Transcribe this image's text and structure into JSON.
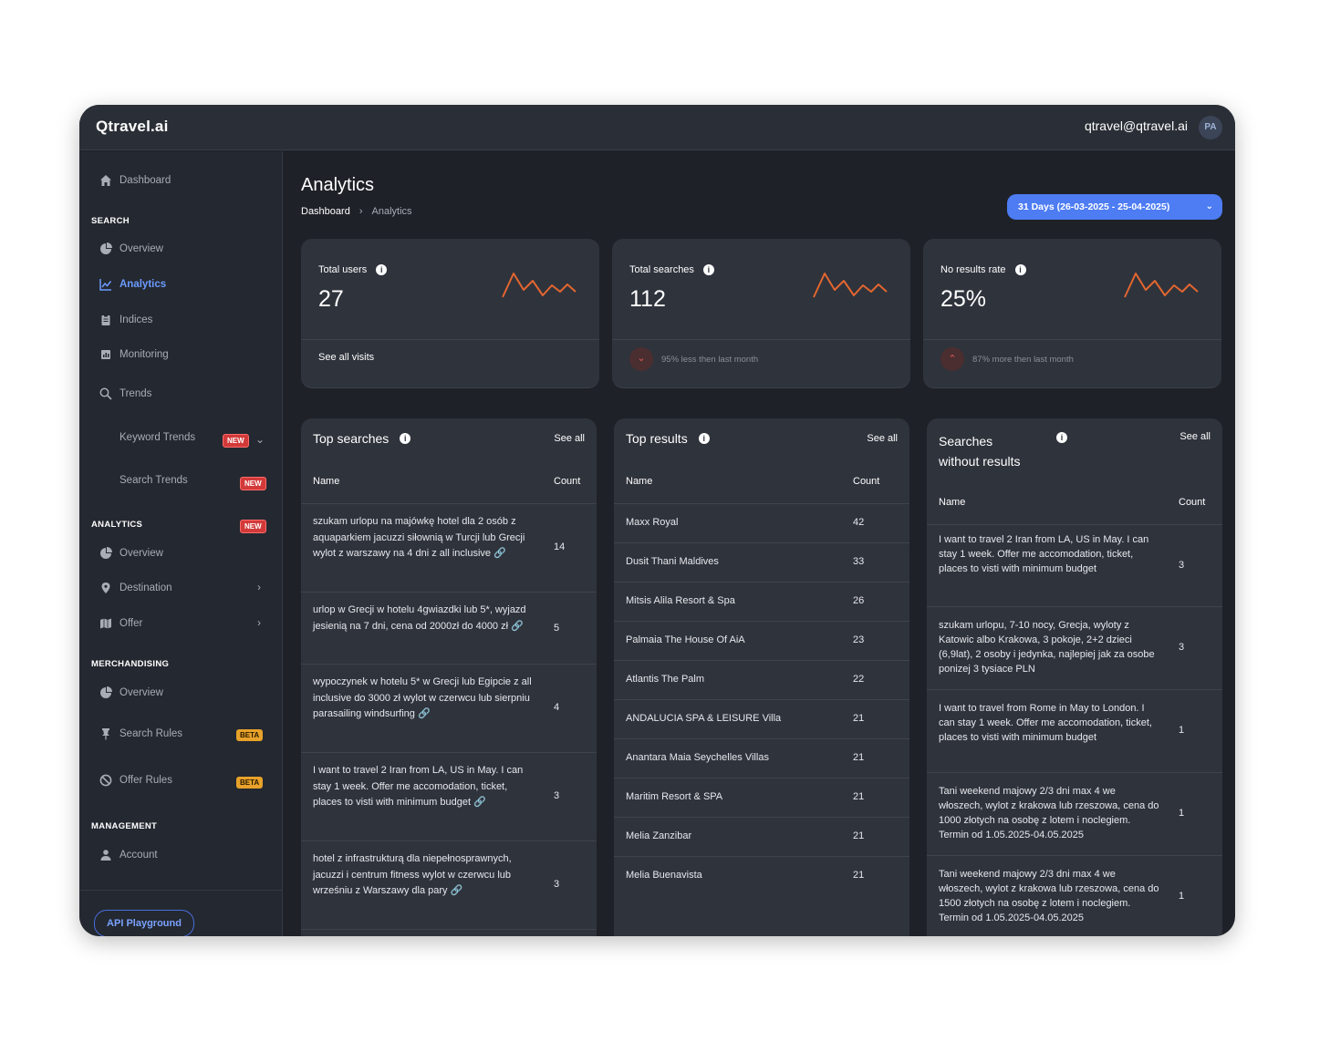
{
  "header": {
    "logo": "Qtravel.ai",
    "email": "qtravel@qtravel.ai",
    "avatar": "PA"
  },
  "sidebar": {
    "dashboard": "Dashboard",
    "sections": {
      "search": "SEARCH",
      "analytics": "ANALYTICS",
      "merchandising": "MERCHANDISING",
      "management": "MANAGEMENT"
    },
    "search_items": {
      "overview": "Overview",
      "analytics": "Analytics",
      "indices": "Indices",
      "monitoring": "Monitoring",
      "trends": "Trends",
      "keyword_trends": "Keyword Trends",
      "search_trends": "Search Trends"
    },
    "analytics_items": {
      "overview": "Overview",
      "destination": "Destination",
      "offer": "Offer"
    },
    "merch_items": {
      "overview": "Overview",
      "search_rules": "Search Rules",
      "offer_rules": "Offer Rules"
    },
    "management_items": {
      "account": "Account"
    },
    "badges": {
      "new": "NEW",
      "beta": "BETA"
    },
    "api_button": "API Playground"
  },
  "page": {
    "title": "Analytics",
    "breadcrumb": [
      "Dashboard",
      "Analytics"
    ],
    "date_range": "31 Days (26-03-2025 - 25-04-2025)"
  },
  "stats": [
    {
      "label": "Total users",
      "value": "27",
      "footer": "See all visits"
    },
    {
      "label": "Total searches",
      "value": "112",
      "footer": "95% less then last month",
      "trend": "down"
    },
    {
      "label": "No results rate",
      "value": "25%",
      "footer": "87% more then last month",
      "trend": "up"
    }
  ],
  "colors": {
    "accent": "#4d7cf3",
    "spark": "#e3662f",
    "badge_new": "#d23a3a",
    "badge_beta": "#e8a22a"
  },
  "top_searches": {
    "title": "Top searches",
    "see_all": "See all",
    "col_name": "Name",
    "col_count": "Count",
    "rows": [
      {
        "name": "szukam urlopu na majówkę hotel dla 2 osób z aquaparkiem jacuzzi siłownią w Turcji lub Grecji wylot z warszawy na 4 dni z all inclusive 🔗",
        "count": "14"
      },
      {
        "name": "urlop w Grecji w hotelu 4gwiazdki lub 5*, wyjazd jesienią na 7 dni, cena od 2000zł do 4000 zł 🔗",
        "count": "5"
      },
      {
        "name": "wypoczynek w hotelu 5* w Grecji lub Egipcie z all inclusive do 3000 zł wylot w czerwcu lub sierpniu parasailing windsurfing 🔗",
        "count": "4"
      },
      {
        "name": "I want to travel 2 Iran from LA, US in May. I can stay 1 week. Offer me accomodation, ticket, places to visti with minimum budget 🔗",
        "count": "3"
      },
      {
        "name": "hotel z infrastrukturą dla niepełnosprawnych, jacuzzi i centrum fitness wylot w czerwcu lub wrześniu z Warszawy dla pary 🔗",
        "count": "3"
      }
    ]
  },
  "top_results": {
    "title": "Top results",
    "see_all": "See all",
    "col_name": "Name",
    "col_count": "Count",
    "rows": [
      {
        "name": "Maxx Royal",
        "count": "42"
      },
      {
        "name": "Dusit Thani Maldives",
        "count": "33"
      },
      {
        "name": "Mitsis Alila Resort & Spa",
        "count": "26"
      },
      {
        "name": "Palmaia The House Of AiA",
        "count": "23"
      },
      {
        "name": "Atlantis The Palm",
        "count": "22"
      },
      {
        "name": "ANDALUCIA SPA & LEISURE Villa",
        "count": "21"
      },
      {
        "name": "Anantara Maia Seychelles Villas",
        "count": "21"
      },
      {
        "name": "Maritim Resort & SPA",
        "count": "21"
      },
      {
        "name": "Melia Zanzibar",
        "count": "21"
      },
      {
        "name": "Melia Buenavista",
        "count": "21"
      }
    ]
  },
  "no_results": {
    "title_line1": "Searches",
    "title_line2": "without results",
    "see_all": "See all",
    "col_name": "Name",
    "col_count": "Count",
    "rows": [
      {
        "name": "I want to travel 2 Iran from LA, US in May. I can stay 1 week. Offer me accomodation, ticket, places to visti with minimum budget",
        "count": "3"
      },
      {
        "name": "szukam urlopu, 7-10 nocy, Grecja, wyloty z Katowic albo Krakowa, 3 pokoje, 2+2 dzieci (6,9lat), 2 osoby i jedynka, najlepiej jak za osobe ponizej 3 tysiace PLN",
        "count": "3"
      },
      {
        "name": "I want to travel from Rome in May to London. I can stay 1 week. Offer me accomodation, ticket, places to visti with minimum budget",
        "count": "1"
      },
      {
        "name": "Tani weekend majowy 2/3 dni max 4 we włoszech, wylot z krakowa lub rzeszowa, cena do 1000 złotych na osobę z lotem i noclegiem. Termin od 1.05.2025-04.05.2025",
        "count": "1"
      },
      {
        "name": "Tani weekend majowy 2/3 dni max 4 we włoszech, wylot z krakowa lub rzeszowa, cena do 1500 złotych na osobę z lotem i noclegiem. Termin od 1.05.2025-04.05.2025",
        "count": "1"
      }
    ]
  }
}
